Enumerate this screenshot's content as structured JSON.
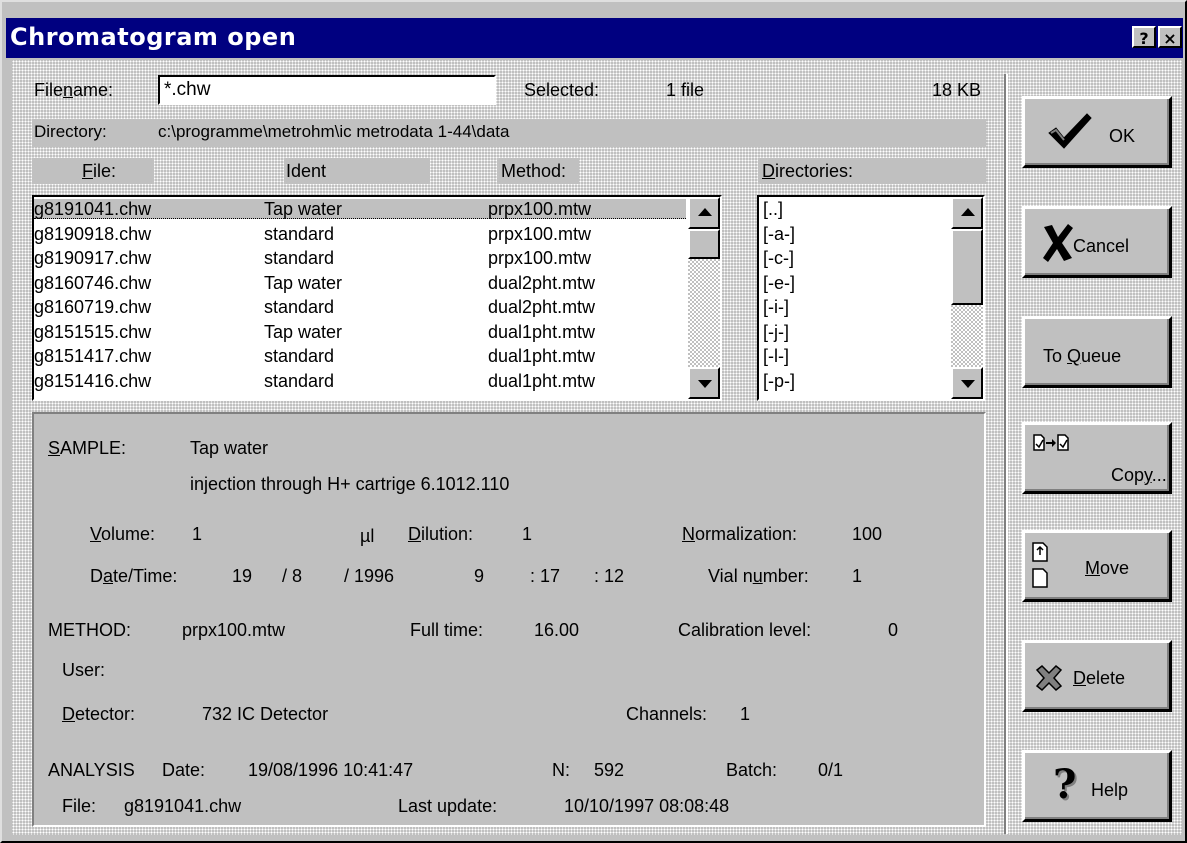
{
  "window": {
    "title": "Chromatogram open",
    "help_button": "?",
    "close_button": "×"
  },
  "filename": {
    "label_pre": "File",
    "label_u": "n",
    "label_post": "ame:",
    "value": "*.chw",
    "selected_label": "Selected:",
    "selected_count": "1 file",
    "selected_size": "18 KB"
  },
  "directory": {
    "label": "Directory:",
    "path": "c:\\programme\\metrohm\\ic metrodata 1-44\\data"
  },
  "file_list": {
    "headers": {
      "file_u": "F",
      "file_rest": "ile:",
      "ident": "Ident",
      "method": "Method:"
    },
    "rows": [
      {
        "file": "g8191041.chw",
        "ident": "Tap water",
        "method": "prpx100.mtw"
      },
      {
        "file": "g8190918.chw",
        "ident": "standard",
        "method": "prpx100.mtw"
      },
      {
        "file": "g8190917.chw",
        "ident": "standard",
        "method": "prpx100.mtw"
      },
      {
        "file": "g8160746.chw",
        "ident": "Tap water",
        "method": "dual2pht.mtw"
      },
      {
        "file": "g8160719.chw",
        "ident": "standard",
        "method": "dual2pht.mtw"
      },
      {
        "file": "g8151515.chw",
        "ident": "Tap water",
        "method": "dual1pht.mtw"
      },
      {
        "file": "g8151417.chw",
        "ident": "standard",
        "method": "dual1pht.mtw"
      },
      {
        "file": "g8151416.chw",
        "ident": "standard",
        "method": "dual1pht.mtw"
      }
    ]
  },
  "directories": {
    "header_u": "D",
    "header_rest": "irectories:",
    "items": [
      "[..]",
      "[-a-]",
      "[-c-]",
      "[-e-]",
      "[-i-]",
      "[-j-]",
      "[-l-]",
      "[-p-]"
    ]
  },
  "details": {
    "sample_u": "S",
    "sample_rest": "AMPLE:",
    "sample_name": "Tap water",
    "sample_desc": "injection through H+ cartrige 6.1012.110",
    "volume_u": "V",
    "volume_rest": "olume:",
    "volume_value": "1",
    "volume_unit": "µl",
    "dilution_u": "D",
    "dilution_rest": "ilution:",
    "dilution_value": "1",
    "normalization_u": "N",
    "normalization_rest": "ormalization:",
    "normalization_value": "100",
    "datetime_pre": "D",
    "datetime_u": "a",
    "datetime_post": "te/Time:",
    "day": "19",
    "month": "/ 8",
    "year": "/ 1996",
    "hour": "9",
    "minute": ": 17",
    "second": ": 12",
    "vial_pre": "Vial n",
    "vial_u": "u",
    "vial_post": "mber:",
    "vial_value": "1",
    "method_label": "METHOD:",
    "method_value": "prpx100.mtw",
    "fulltime_label": "Full time:",
    "fulltime_value": "16.00",
    "calib_label": "Calibration level:",
    "calib_value": "0",
    "user_label": "User:",
    "detector_u": "D",
    "detector_rest": "etector:",
    "detector_value": "732 IC Detector",
    "channels_label": "Channels:",
    "channels_value": "1",
    "analysis_label": "ANALYSIS",
    "analysis_date_label": "Date:",
    "analysis_date_value": "19/08/1996 10:41:47",
    "n_label": "N:",
    "n_value": "592",
    "batch_label": "Batch:",
    "batch_value": "0/1",
    "file_label": "File:",
    "file_value": "g8191041.chw",
    "lastupdate_label": "Last update:",
    "lastupdate_value": "10/10/1997 08:08:48"
  },
  "buttons": {
    "ok": "OK",
    "cancel": "Cancel",
    "queue_pre": "To ",
    "queue_u": "Q",
    "queue_post": "ueue",
    "copy_pre": "Cop",
    "copy_u": "y",
    "copy_post": "...",
    "move_u": "M",
    "move_rest": "ove",
    "delete_u": "D",
    "delete_rest": "elete",
    "help": "Help"
  },
  "colors": {
    "titlebar": "#000080",
    "face": "#c0c0c0",
    "highlight": "#ffffff",
    "shadow": "#808080"
  },
  "icons": [
    "checkmark-icon",
    "x-mark-icon",
    "copy-files-icon",
    "move-files-icon",
    "delete-icon",
    "question-icon"
  ]
}
